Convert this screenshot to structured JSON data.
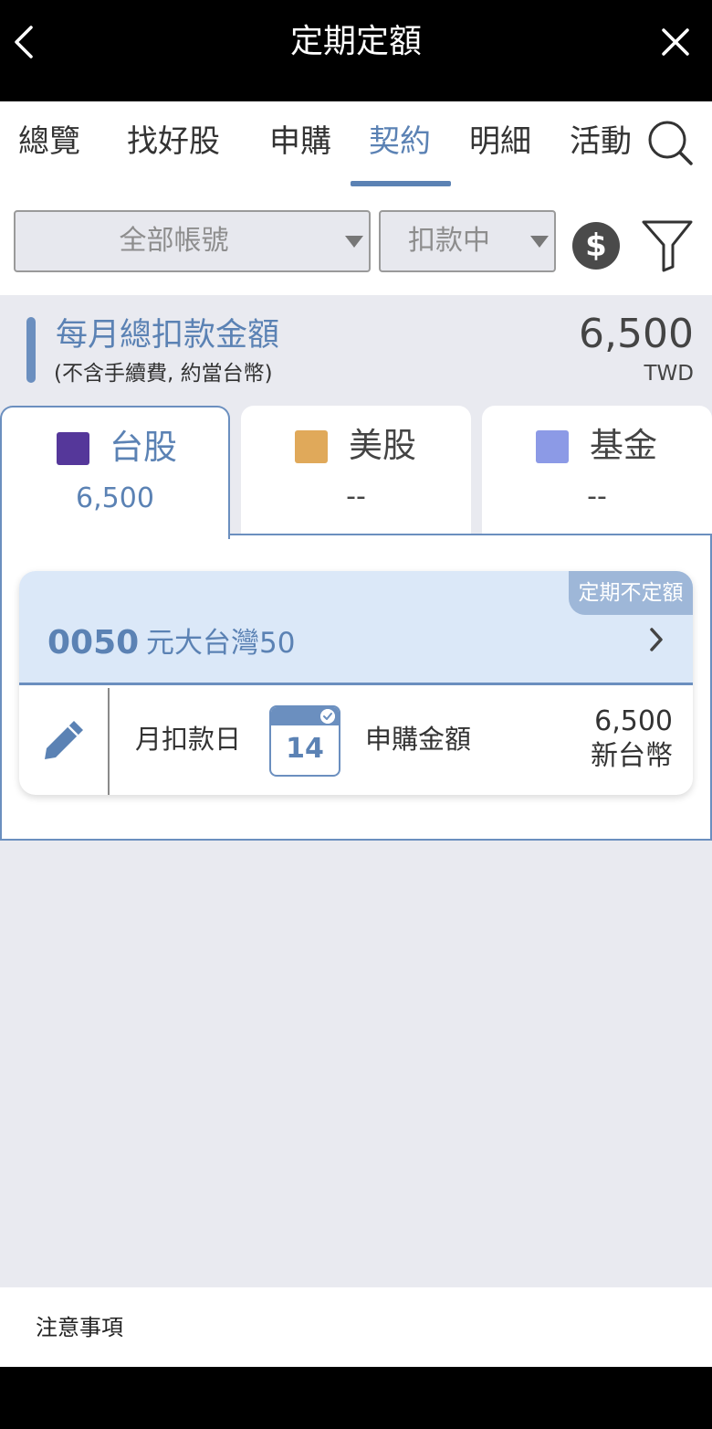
{
  "header": {
    "title": "定期定額",
    "back_icon": "chevron-left-icon",
    "close_icon": "close-icon"
  },
  "tabs": [
    {
      "label": "總覽"
    },
    {
      "label": "找好股"
    },
    {
      "label": "申購"
    },
    {
      "label": "契約",
      "active": true
    },
    {
      "label": "明細"
    },
    {
      "label": "活動"
    }
  ],
  "filters": {
    "account": "全部帳號",
    "status": "扣款中",
    "currency_symbol": "$"
  },
  "summary": {
    "title": "每月總扣款金額",
    "subtitle": "(不含手續費, 約當台幣)",
    "amount": "6,500",
    "unit": "TWD"
  },
  "categories": [
    {
      "name": "台股",
      "value": "6,500",
      "color": "#55379a",
      "active": true
    },
    {
      "name": "美股",
      "value": "--",
      "color": "#e0a95a"
    },
    {
      "name": "基金",
      "value": "--",
      "color": "#8c9ae6"
    }
  ],
  "contract": {
    "badge": "定期不定額",
    "code": "0050",
    "name": "元大台灣50",
    "day_label": "月扣款日",
    "day": "14",
    "amount_label": "申購金額",
    "amount": "6,500",
    "amount_unit": "新台幣"
  },
  "footer": {
    "notice": "注意事項"
  },
  "colors": {
    "accent": "#5b82b4",
    "header_bg": "#000000",
    "card_head_bg": "#dbe8f8"
  }
}
